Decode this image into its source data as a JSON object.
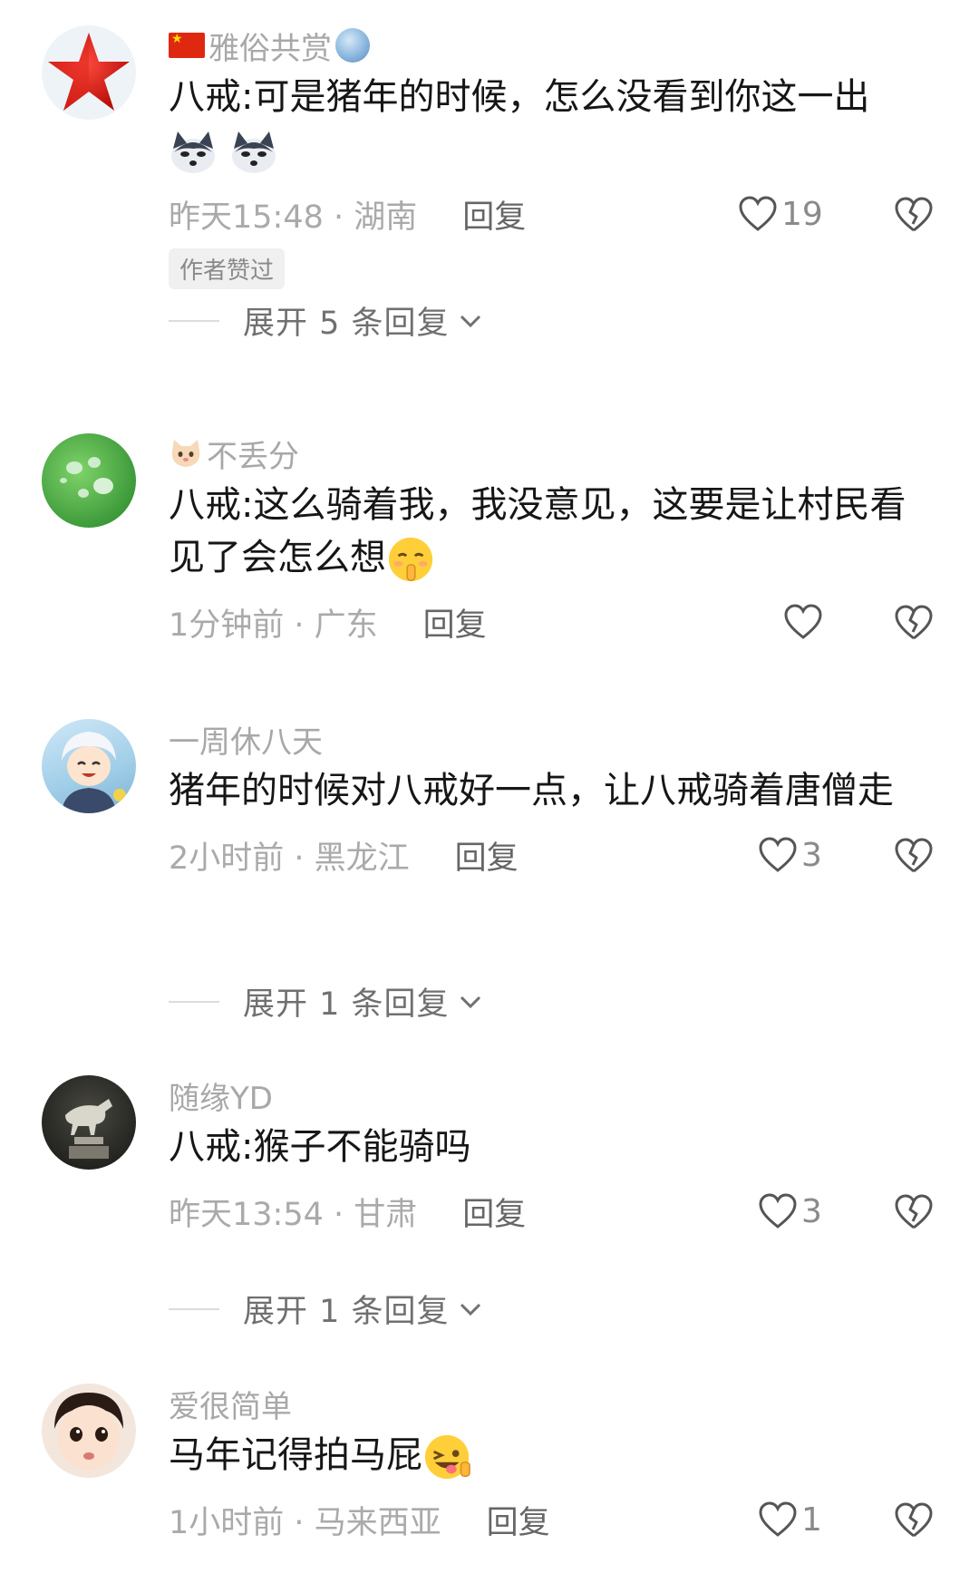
{
  "comments": [
    {
      "username": "雅俗共赏",
      "text": "八戒:可是猪年的时候，怎么没看到你这一出",
      "meta": "昨天15:48 · 湖南",
      "reply_label": "回复",
      "likes": "19",
      "badge": "作者赞过",
      "expand": "展开 5 条回复",
      "avatar_icon": "red-star-icon",
      "emojis": [
        "husky-emoji",
        "husky-emoji"
      ]
    },
    {
      "username": "不丢分",
      "text": "八戒:这么骑着我，我没意见，这要是让村民看见了会怎么想",
      "meta": "1分钟前 · 广东",
      "reply_label": "回复",
      "likes": "",
      "avatar_icon": "water-drops-leaf-icon",
      "emojis": [
        "shushing-face-emoji"
      ]
    },
    {
      "username": "一周休八天",
      "text": "猪年的时候对八戒好一点，让八戒骑着唐僧走",
      "meta": "2小时前 · 黑龙江",
      "reply_label": "回复",
      "likes": "3",
      "expand": "展开 1 条回复",
      "avatar_icon": "anime-boy-icon"
    },
    {
      "username": "随缘YD",
      "text": "八戒:猴子不能骑吗",
      "meta": "昨天13:54 · 甘肃",
      "reply_label": "回复",
      "likes": "3",
      "expand": "展开 1 条回复",
      "avatar_icon": "horse-statue-icon"
    },
    {
      "username": "爱很简单",
      "text": "马年记得拍马屁",
      "meta": "1小时前 · 马来西亚",
      "reply_label": "回复",
      "likes": "1",
      "avatar_icon": "child-face-icon",
      "emojis": [
        "winking-tongue-emoji"
      ]
    }
  ],
  "colors": {
    "username": "#a8a8a8",
    "text": "#161616",
    "meta": "#aaaaaa",
    "reply": "#666666",
    "divider": "#dcdcdc"
  }
}
